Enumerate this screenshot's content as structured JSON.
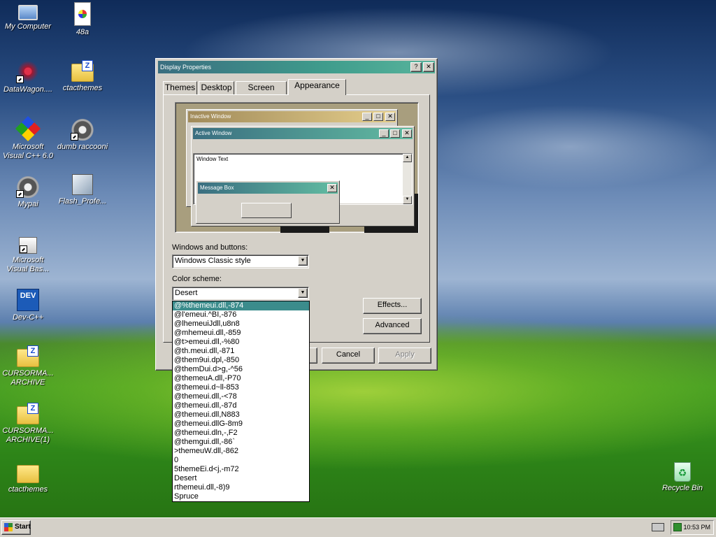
{
  "desktop": {
    "icons": [
      {
        "label": "My Computer"
      },
      {
        "label": "48a"
      },
      {
        "label": "DataWagon...."
      },
      {
        "label": "ctacthemes"
      },
      {
        "label": "Microsoft Visual C++ 6.0"
      },
      {
        "label": "dumb raccooni"
      },
      {
        "label": "Mypai"
      },
      {
        "label": "Flash_Profe..."
      },
      {
        "label": "Microsoft Visual Bas..."
      },
      {
        "label": "Dev-C++",
        "glyph": "DEV"
      },
      {
        "label": "CURSORMA... ARCHIVE"
      },
      {
        "label": "CURSORMA... ARCHIVE(1)"
      },
      {
        "label": "ctacthemes"
      },
      {
        "label": "Recycle Bin"
      }
    ]
  },
  "window": {
    "title": "Display Properties",
    "help_glyph": "?",
    "close_glyph": "✕",
    "tabs": [
      {
        "label": "Themes"
      },
      {
        "label": "Desktop"
      },
      {
        "label": "Screen Saver"
      },
      {
        "label": "Appearance",
        "active": true
      }
    ],
    "preview": {
      "inactive_title": "Inactive Window",
      "active_title": "Active Window",
      "window_text": "Window Text",
      "message_title": "Message Box",
      "min_glyph": "_",
      "max_glyph": "□",
      "close_glyph": "✕",
      "scroll_up": "▲",
      "scroll_down": "▼"
    },
    "windows_and_buttons_label": "Windows and buttons:",
    "windows_and_buttons_value": "Windows Classic style",
    "color_scheme_label": "Color scheme:",
    "color_scheme_value": "Desert",
    "dropdown_arrow": "▼",
    "effects_label": "Effects...",
    "advanced_label": "Advanced",
    "cancel_label": "Cancel",
    "apply_label": "Apply",
    "color_scheme_options": [
      "@%themeui.dll,-874",
      "@l'emeui.^BI,-876",
      "@lhemeuiJdll,u8n8",
      "@mhemeui.dll,-859",
      "@t>emeui.dll,-%80",
      "@th.meui.dll,-871",
      "@them9ui.dpl,-850",
      "@themDui.d>g,-^56",
      "@themeuA.dll,-P70",
      "@themeui.d~ll-853",
      "@themeui.dll,-<78",
      "@themeui.dll,-87d",
      "@themeui.dll,N883",
      "@themeui.dllG-8m9",
      "@themeui.dln,-,F2",
      "@themgui.dll,-86`",
      ">themeuW.dll,-862",
      "0",
      "5themeEi.d<j,-m72",
      "Desert",
      "rthemeui.dll,-8)9",
      "Spruce"
    ],
    "selected_option_index": 0
  },
  "taskbar": {
    "start_label": "Start",
    "clock": "10:53 PM"
  }
}
